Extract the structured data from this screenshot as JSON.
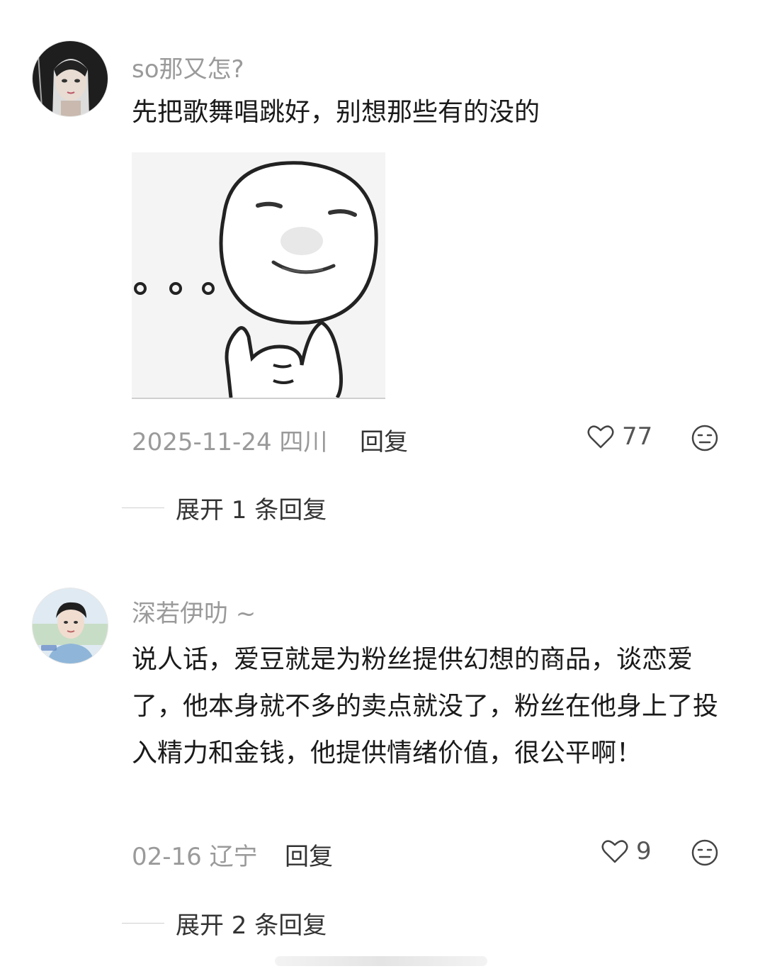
{
  "comments": [
    {
      "username": "so那又怎?",
      "text": "先把歌舞唱跳好，别想那些有的没的",
      "has_sticker": true,
      "date": "2025-11-24",
      "location": "四川",
      "reply_label": "回复",
      "likes": "77",
      "expand_label": "展开 1 条回复",
      "avatar_icon": "anime-girl-avatar-icon"
    },
    {
      "username": "深若伊叻 ~",
      "text": "说人话，爱豆就是为粉丝提供幻想的商品，谈恋爱了，他本身就不多的卖点就没了，粉丝在他身上了投入精力和金钱，他提供情绪价值，很公平啊！",
      "has_sticker": false,
      "date": "02-16",
      "location": "辽宁",
      "reply_label": "回复",
      "likes": "9",
      "expand_label": "展开 2 条回复",
      "avatar_icon": "young-man-avatar-icon"
    }
  ],
  "colors": {
    "text": "#1a1a1a",
    "meta": "#9a9a9a",
    "action": "#333333"
  }
}
